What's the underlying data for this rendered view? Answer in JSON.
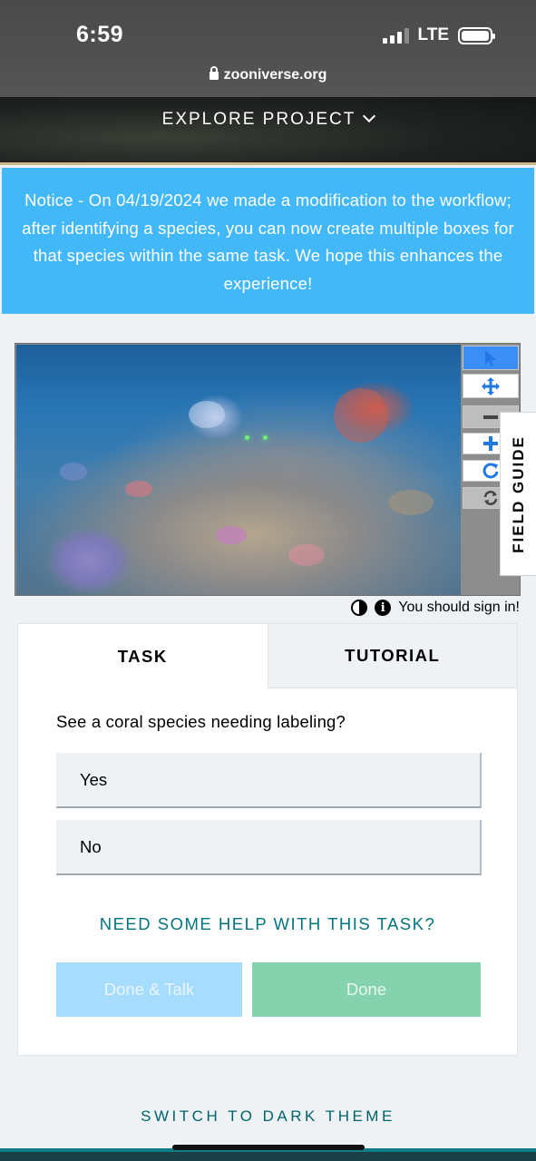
{
  "status_bar": {
    "time": "6:59",
    "network": "LTE",
    "url": "zooniverse.org"
  },
  "header": {
    "explore_label": "EXPLORE PROJECT"
  },
  "notice": {
    "text": "Notice - On 04/19/2024 we made a modification to the workflow; after identifying a species, you can now create multiple boxes for that species within the same task. We hope this enhances the experience!"
  },
  "viewer": {
    "tools": [
      "pointer-icon",
      "move-icon",
      "zoom-out-icon",
      "zoom-in-icon",
      "rotate-icon",
      "reset-icon"
    ],
    "field_guide_label": "FIELD GUIDE",
    "signin_text": "You should sign in!"
  },
  "task_panel": {
    "tabs": [
      {
        "label": "TASK",
        "active": true
      },
      {
        "label": "TUTORIAL",
        "active": false
      }
    ],
    "question": "See a coral species needing labeling?",
    "answers": [
      "Yes",
      "No"
    ],
    "help_link": "NEED SOME HELP WITH THIS TASK?",
    "done_talk_label": "Done & Talk",
    "done_label": "Done"
  },
  "footer": {
    "dark_theme_label": "SWITCH TO DARK THEME"
  },
  "colors": {
    "notice_bg": "#43b8f9",
    "done_talk_bg": "#a6dcfd",
    "done_bg": "#85d2ae",
    "teal_link": "#00757e"
  }
}
